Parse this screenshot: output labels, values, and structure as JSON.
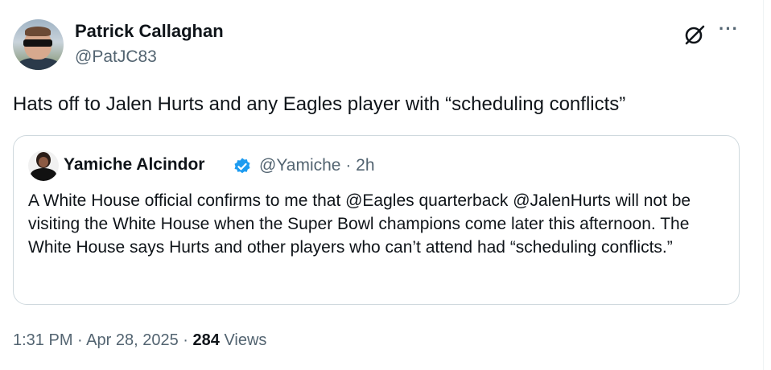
{
  "author": {
    "name": "Patrick Callaghan",
    "handle": "@PatJC83"
  },
  "tweet": {
    "text": "Hats off to Jalen Hurts and any Eagles player with “scheduling conflicts”"
  },
  "quote": {
    "name": "Yamiche Alcindor",
    "handle": "@Yamiche",
    "separator": "·",
    "time": "2h",
    "verified": true,
    "text": "A White House official confirms to me that @Eagles quarterback @JalenHurts will not be visiting the White House when the Super Bowl champions come later this afternoon. The White House says Hurts and other players who can’t attend had “scheduling conflicts.”"
  },
  "meta": {
    "time": "1:31 PM",
    "separator": "·",
    "date": "Apr 28, 2025",
    "views_count": "284",
    "views_label": "Views"
  },
  "icons": {
    "grok": "grok-icon",
    "more": "more-dots-icon",
    "verified": "verified-badge-icon"
  },
  "colors": {
    "text": "#0f1419",
    "secondary": "#536471",
    "border": "#cfd9de",
    "verified": "#1d9bf0"
  }
}
